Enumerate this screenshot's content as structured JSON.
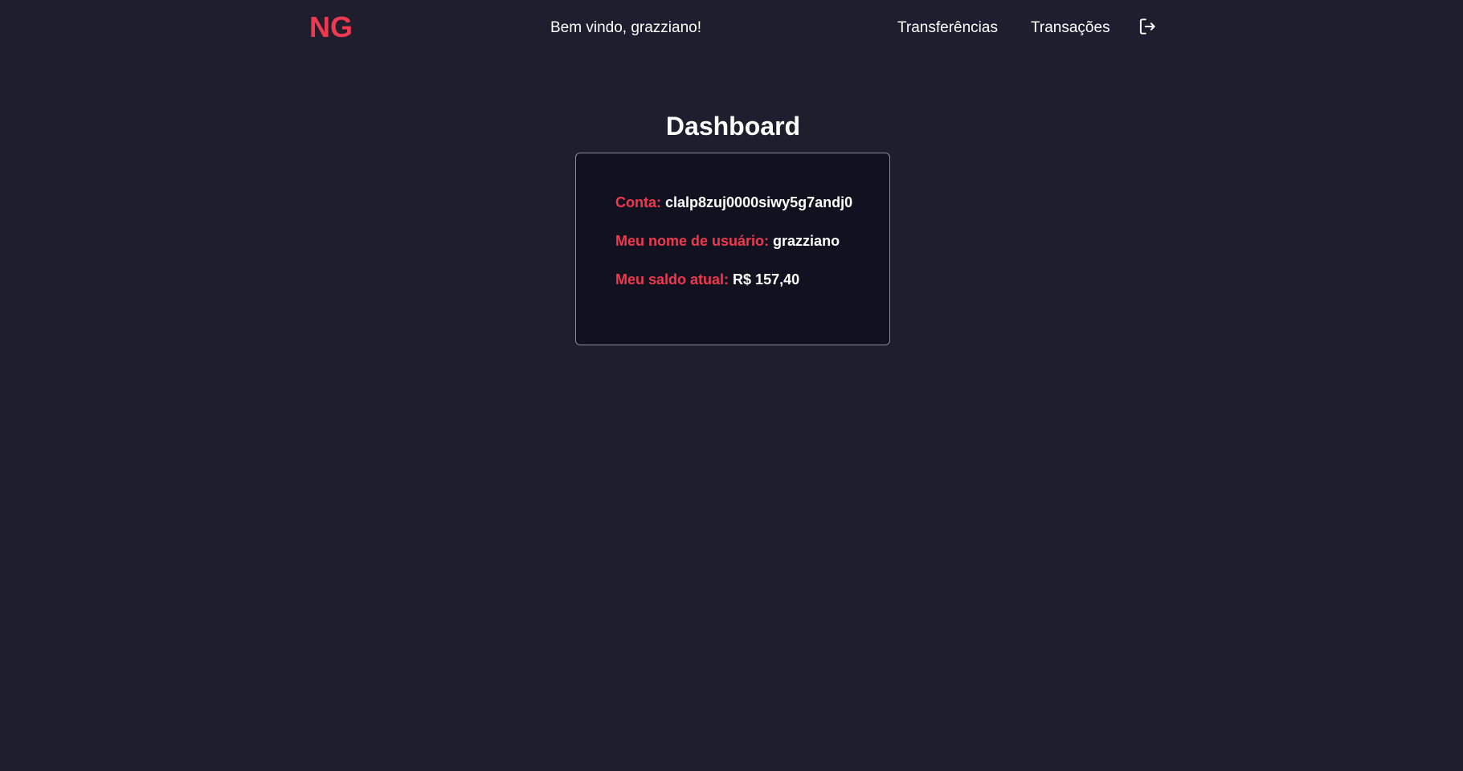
{
  "header": {
    "logo": "NG",
    "welcome": "Bem vindo, grazziano!",
    "nav": {
      "transfers": "Transferências",
      "transactions": "Transações"
    },
    "logout_icon": "logout-icon"
  },
  "main": {
    "title": "Dashboard",
    "account": {
      "label": "Conta:",
      "value": "clalp8zuj0000siwy5g7andj0"
    },
    "username": {
      "label": "Meu nome de usuário:",
      "value": "grazziano"
    },
    "balance": {
      "label": "Meu saldo atual:",
      "value": "R$ 157,40"
    }
  },
  "colors": {
    "background": "#1e1e2e",
    "card_background": "#11111f",
    "accent": "#f0394f",
    "text": "#ffffff"
  }
}
